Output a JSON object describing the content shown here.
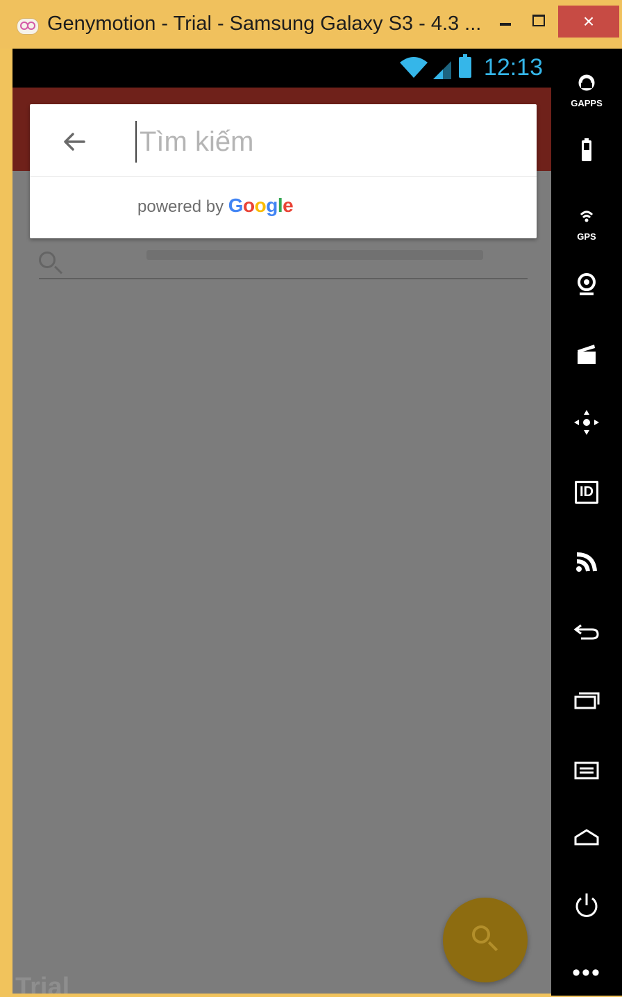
{
  "window": {
    "title": "Genymotion - Trial - Samsung Galaxy S3 - 4.3 ...",
    "close_label": "×"
  },
  "statusbar": {
    "time": "12:13",
    "accent_color": "#35b6e9"
  },
  "search": {
    "placeholder": "Tìm kiếm",
    "value": "",
    "powered_by": "powered by",
    "google": {
      "letters": [
        "G",
        "o",
        "o",
        "g",
        "l",
        "e"
      ],
      "colors": [
        "#4285F4",
        "#EA4335",
        "#FBBC05",
        "#4285F4",
        "#34A853",
        "#EA4335"
      ]
    }
  },
  "colors": {
    "appbar": "#6f211a",
    "fab": "#8d6c10",
    "overlay": "#7c7c7c",
    "frame": "#f1c35c"
  },
  "watermark": "Trial",
  "toolbar": {
    "items": [
      {
        "icon": "gapps-icon",
        "label": "GAPPS"
      },
      {
        "icon": "battery-icon",
        "label": ""
      },
      {
        "icon": "gps-icon",
        "label": "GPS"
      },
      {
        "icon": "webcam-icon",
        "label": ""
      },
      {
        "icon": "capture-icon",
        "label": ""
      },
      {
        "icon": "dpad-icon",
        "label": ""
      },
      {
        "icon": "id-icon",
        "label": "ID"
      },
      {
        "icon": "rss-icon",
        "label": ""
      },
      {
        "icon": "back-icon",
        "label": ""
      },
      {
        "icon": "recent-apps-icon",
        "label": ""
      },
      {
        "icon": "menu-icon",
        "label": ""
      },
      {
        "icon": "home-icon",
        "label": ""
      },
      {
        "icon": "power-icon",
        "label": ""
      },
      {
        "icon": "more-icon",
        "label": "•••"
      }
    ]
  }
}
